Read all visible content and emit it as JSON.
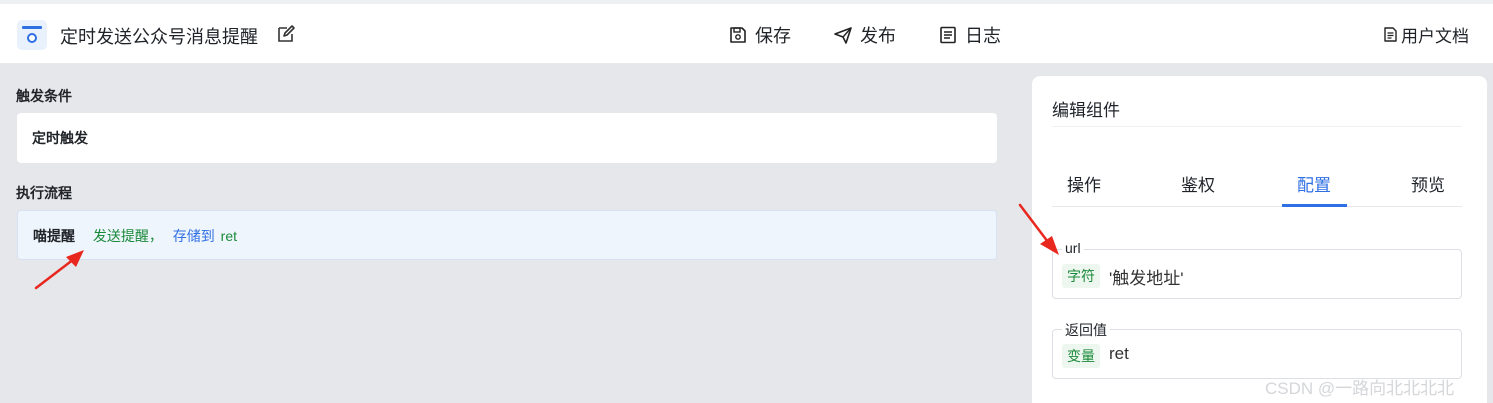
{
  "header": {
    "app_title": "定时发送公众号消息提醒",
    "toolbar": {
      "save_label": "保存",
      "publish_label": "发布",
      "log_label": "日志"
    },
    "docs_label": "用户文档"
  },
  "main": {
    "trigger_section_label": "触发条件",
    "trigger_value": "定时触发",
    "flow_section_label": "执行流程",
    "flow_step": {
      "name": "喵提醒",
      "action": "发送提醒，",
      "store_label": "存储到",
      "store_var": "ret"
    }
  },
  "panel": {
    "title": "编辑组件",
    "tabs": [
      "操作",
      "鉴权",
      "配置",
      "预览"
    ],
    "active_tab": "配置",
    "fields": [
      {
        "label": "url",
        "type_tag": "字符",
        "value": "'触发地址'"
      },
      {
        "label": "返回值",
        "type_tag": "变量",
        "value": "ret"
      }
    ]
  },
  "watermark": "CSDN @一路向北北北北",
  "colors": {
    "accent": "#2f6fe4",
    "green": "#1a8a3a",
    "annotation_arrow": "#e8281e"
  }
}
